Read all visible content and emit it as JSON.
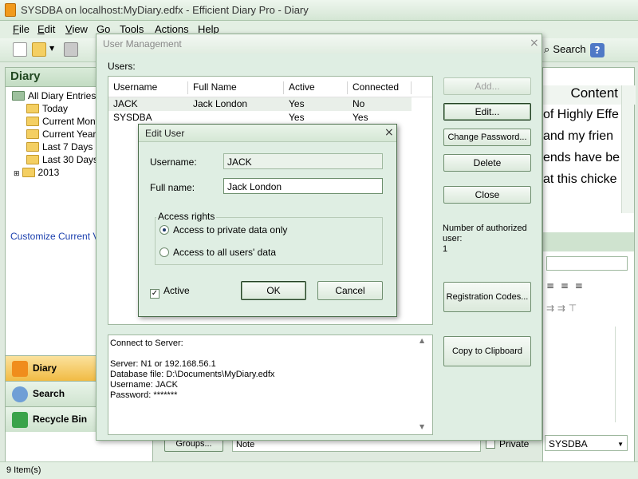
{
  "window": {
    "title": "SYSDBA on localhost:MyDiary.edfx - Efficient Diary Pro - Diary"
  },
  "menu": [
    {
      "key": "F",
      "rest": "ile"
    },
    {
      "key": "E",
      "rest": "dit"
    },
    {
      "key": "V",
      "rest": "iew"
    },
    {
      "key": "G",
      "rest": "o"
    },
    {
      "key": "T",
      "rest": "ools"
    },
    {
      "key": "A",
      "rest": "ctions"
    },
    {
      "key": "H",
      "rest": "elp"
    }
  ],
  "toolbar": {
    "search_label": "Search"
  },
  "left": {
    "header": "Diary",
    "tree": [
      "All Diary Entries",
      "Today",
      "Current Month",
      "Current Year",
      "Last 7 Days",
      "Last 30 Days",
      "2013"
    ],
    "customize_link": "Customize Current View",
    "nav": [
      "Diary",
      "Search",
      "Recycle Bin"
    ]
  },
  "right": {
    "content_header": "Content",
    "lines": [
      "of Highly Effe",
      "and my frien",
      "ends have be",
      "at this chicke"
    ],
    "user_select": "SYSDBA"
  },
  "bottom": {
    "groups_label": "Groups...",
    "note_label": "Note",
    "private_label": "Private"
  },
  "status": {
    "items": "9 Item(s)"
  },
  "user_management": {
    "title": "User Management",
    "users_label": "Users:",
    "columns": [
      "Username",
      "Full Name",
      "Active",
      "Connected"
    ],
    "rows": [
      [
        "JACK",
        "Jack London",
        "Yes",
        "No"
      ],
      [
        "SYSDBA",
        "",
        "Yes",
        "Yes"
      ]
    ],
    "buttons": {
      "add": "Add...",
      "edit": "Edit...",
      "change_password": "Change Password...",
      "delete": "Delete",
      "close": "Close",
      "registration": "Registration Codes...",
      "copy": "Copy to Clipboard"
    },
    "authorized_label": "Number of authorized user:",
    "authorized_count": "1",
    "connect_info": [
      "Connect to Server:",
      "",
      "Server: N1 or 192.168.56.1",
      "Database file: D:\\Documents\\MyDiary.edfx",
      "Username: JACK",
      "Password: *******"
    ]
  },
  "edit_user": {
    "title": "Edit User",
    "username_label": "Username:",
    "username_value": "JACK",
    "fullname_label": "Full name:",
    "fullname_value": "Jack London",
    "access_rights_label": "Access rights",
    "options": [
      "Access to private data only",
      "Access to all users' data"
    ],
    "selected_option": 0,
    "active_label": "Active",
    "active_checked": true,
    "ok_label": "OK",
    "cancel_label": "Cancel"
  }
}
